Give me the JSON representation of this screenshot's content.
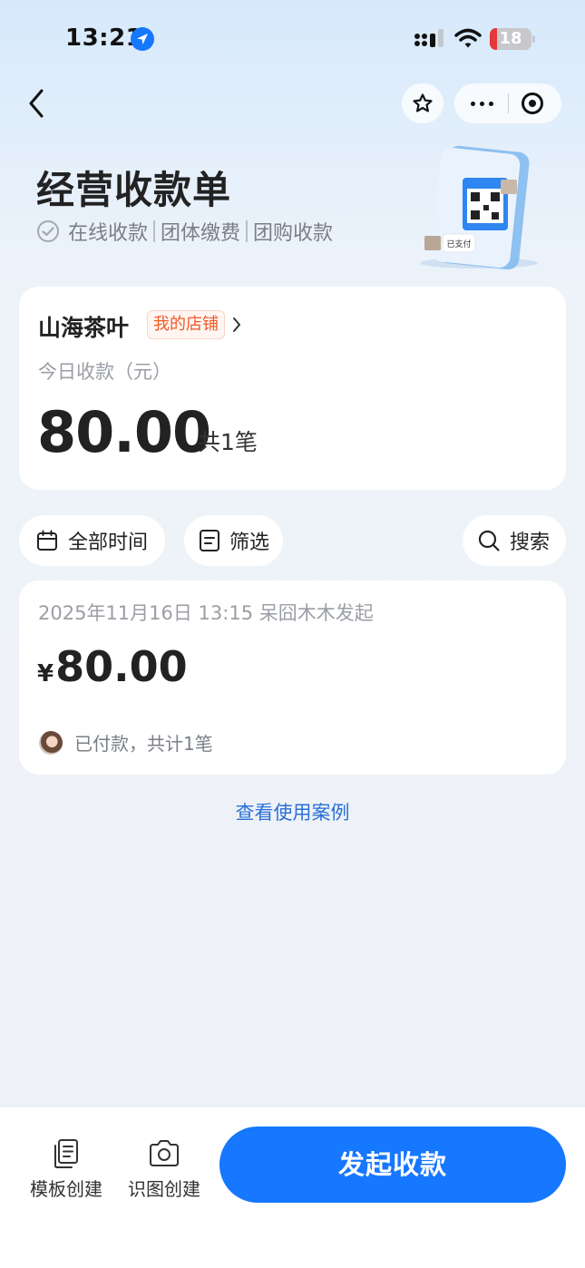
{
  "status_bar": {
    "time": "13:21",
    "battery": "18",
    "battery_level": 0.18
  },
  "header": {
    "title": "经营收款单",
    "features": [
      "在线收款",
      "团体缴费",
      "团购收款"
    ]
  },
  "illustration": {
    "paid_tag": "已支付"
  },
  "shop": {
    "name": "山海茶叶",
    "tag": "我的店铺",
    "today_label": "今日收款（元）",
    "today_amount": "80.00",
    "today_count": "共1笔"
  },
  "filters": {
    "time": "全部时间",
    "filter": "筛选",
    "search": "搜索"
  },
  "record": {
    "meta": "2025年11月16日 13:15 呆囧木木发起",
    "currency": "¥",
    "amount": "80.00",
    "status": "已付款，共计1笔"
  },
  "usage_link": "查看使用案例",
  "bottom_bar": {
    "template_create": "模板创建",
    "image_create": "识图创建",
    "start_collect": "发起收款"
  },
  "colors": {
    "accent": "#1677ff",
    "tag_orange": "#f05a28",
    "link_blue": "#2b6fd6"
  }
}
